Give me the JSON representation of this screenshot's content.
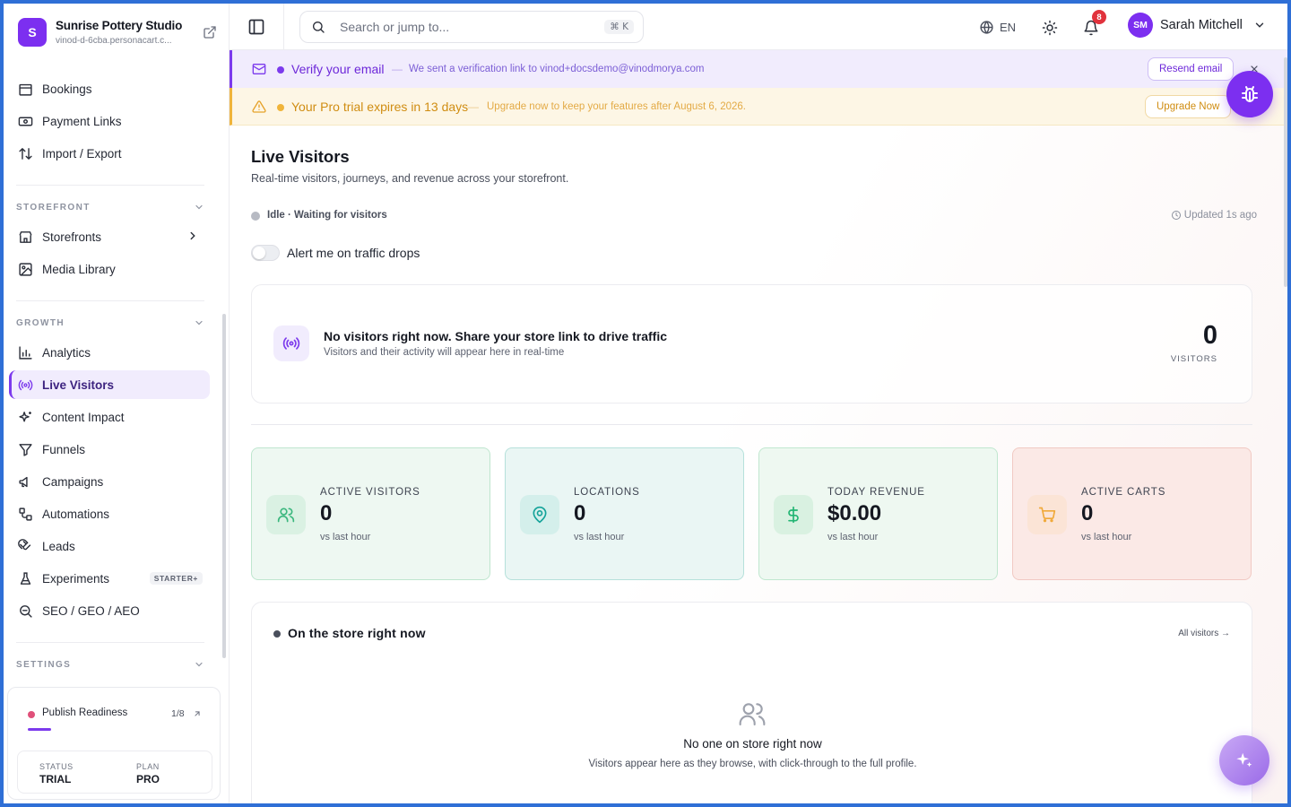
{
  "brand": {
    "initial": "S",
    "name": "Sunrise Pottery Studio",
    "domain": "vinod-d-6cba.personacart.c..."
  },
  "sidebar": {
    "items_top": [
      {
        "label": "Bookings",
        "icon": "calendar-icon"
      },
      {
        "label": "Payment Links",
        "icon": "banknote-icon"
      },
      {
        "label": "Import / Export",
        "icon": "arrow-up-down-icon"
      }
    ],
    "storefront_label": "STOREFRONT",
    "storefront_items": [
      {
        "label": "Storefronts",
        "icon": "store-icon"
      },
      {
        "label": "Media Library",
        "icon": "image-icon"
      }
    ],
    "growth_label": "GROWTH",
    "growth_items": [
      {
        "label": "Analytics",
        "icon": "bar-chart-icon"
      },
      {
        "label": "Live Visitors",
        "icon": "radio-icon",
        "active": true
      },
      {
        "label": "Content Impact",
        "icon": "sparkles-icon"
      },
      {
        "label": "Funnels",
        "icon": "funnel-icon"
      },
      {
        "label": "Campaigns",
        "icon": "megaphone-icon"
      },
      {
        "label": "Automations",
        "icon": "workflow-icon"
      },
      {
        "label": "Leads",
        "icon": "magnet-icon"
      },
      {
        "label": "Experiments",
        "icon": "flask-icon",
        "tag": "STARTER+"
      },
      {
        "label": "SEO / GEO / AEO",
        "icon": "search-zoom-icon"
      }
    ],
    "settings_label": "SETTINGS",
    "publish": {
      "title": "Publish Readiness",
      "count": "1/8",
      "status_label": "STATUS",
      "status_value": "TRIAL",
      "plan_label": "PLAN",
      "plan_value": "PRO"
    }
  },
  "topbar": {
    "search_placeholder": "Search or jump to...",
    "search_shortcut": "⌘ K",
    "language": "EN",
    "notification_count": "8",
    "user_initials": "SM",
    "user_name": "Sarah Mitchell"
  },
  "banners": {
    "verify": {
      "title": "Verify your email",
      "separator": "—",
      "message": "We sent a verification link to vinod+docsdemo@vinodmorya.com",
      "button": "Resend email"
    },
    "trial": {
      "title": "Your Pro trial expires in 13 days",
      "separator": "—",
      "message": "Upgrade now to keep your features after August 6, 2026.",
      "button": "Upgrade Now"
    }
  },
  "page": {
    "title": "Live Visitors",
    "subtitle": "Real-time visitors, journeys, and revenue across your storefront.",
    "status": "Idle · Waiting for visitors",
    "updated": "Updated 1s ago",
    "alert_toggle_label": "Alert me on traffic drops",
    "alert_toggle_on": false
  },
  "empty_state": {
    "title": "No visitors right now. Share your store link to drive traffic",
    "subtitle": "Visitors and their activity will appear here in real-time",
    "count": "0",
    "count_label": "VISITORS"
  },
  "kpis": [
    {
      "label": "ACTIVE VISITORS",
      "value": "0",
      "compare": "vs last hour",
      "icon": "users-icon",
      "accent": "#3bb77e"
    },
    {
      "label": "LOCATIONS",
      "value": "0",
      "compare": "vs last hour",
      "icon": "map-pin-icon",
      "accent": "#14a39a"
    },
    {
      "label": "TODAY REVENUE",
      "value": "$0.00",
      "compare": "vs last hour",
      "icon": "dollar-icon",
      "accent": "#22b573"
    },
    {
      "label": "ACTIVE CARTS",
      "value": "0",
      "compare": "vs last hour",
      "icon": "cart-icon",
      "accent": "#f0a93a"
    }
  ],
  "store_now": {
    "title": "On the store right now",
    "link": "All visitors →",
    "empty_title": "No one on store right now",
    "empty_subtitle": "Visitors appear here as they browse, with click-through to the full profile."
  },
  "colors": {
    "brand": "#7c2ff0",
    "active_nav_bg": "#f1ecfd",
    "trial_accent": "#f0b43a"
  }
}
